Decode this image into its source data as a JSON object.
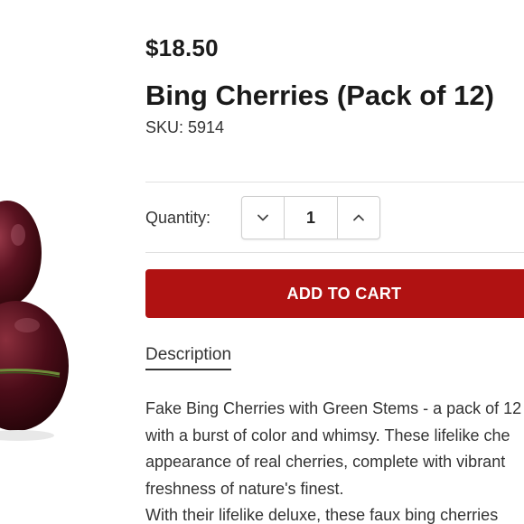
{
  "product": {
    "price": "$18.50",
    "title": "Bing Cherries (Pack of 12)",
    "sku": "SKU: 5914",
    "image_alt": "cherries-image"
  },
  "quantity": {
    "label": "Quantity:",
    "value": "1",
    "decrease_icon": "chevron-down-icon",
    "increase_icon": "chevron-up-icon"
  },
  "cart": {
    "add_label": "ADD TO CART"
  },
  "description": {
    "tab_label": "Description",
    "lines": [
      "Fake Bing Cherries with Green Stems - a pack of 12",
      "with a burst of color and whimsy. These lifelike che",
      "appearance of real cherries, complete with vibrant",
      "freshness of nature's finest.",
      "With their lifelike deluxe, these faux bing cherries"
    ]
  },
  "colors": {
    "accent": "#b01212",
    "text": "#222222",
    "divider": "#e0e0e0"
  }
}
